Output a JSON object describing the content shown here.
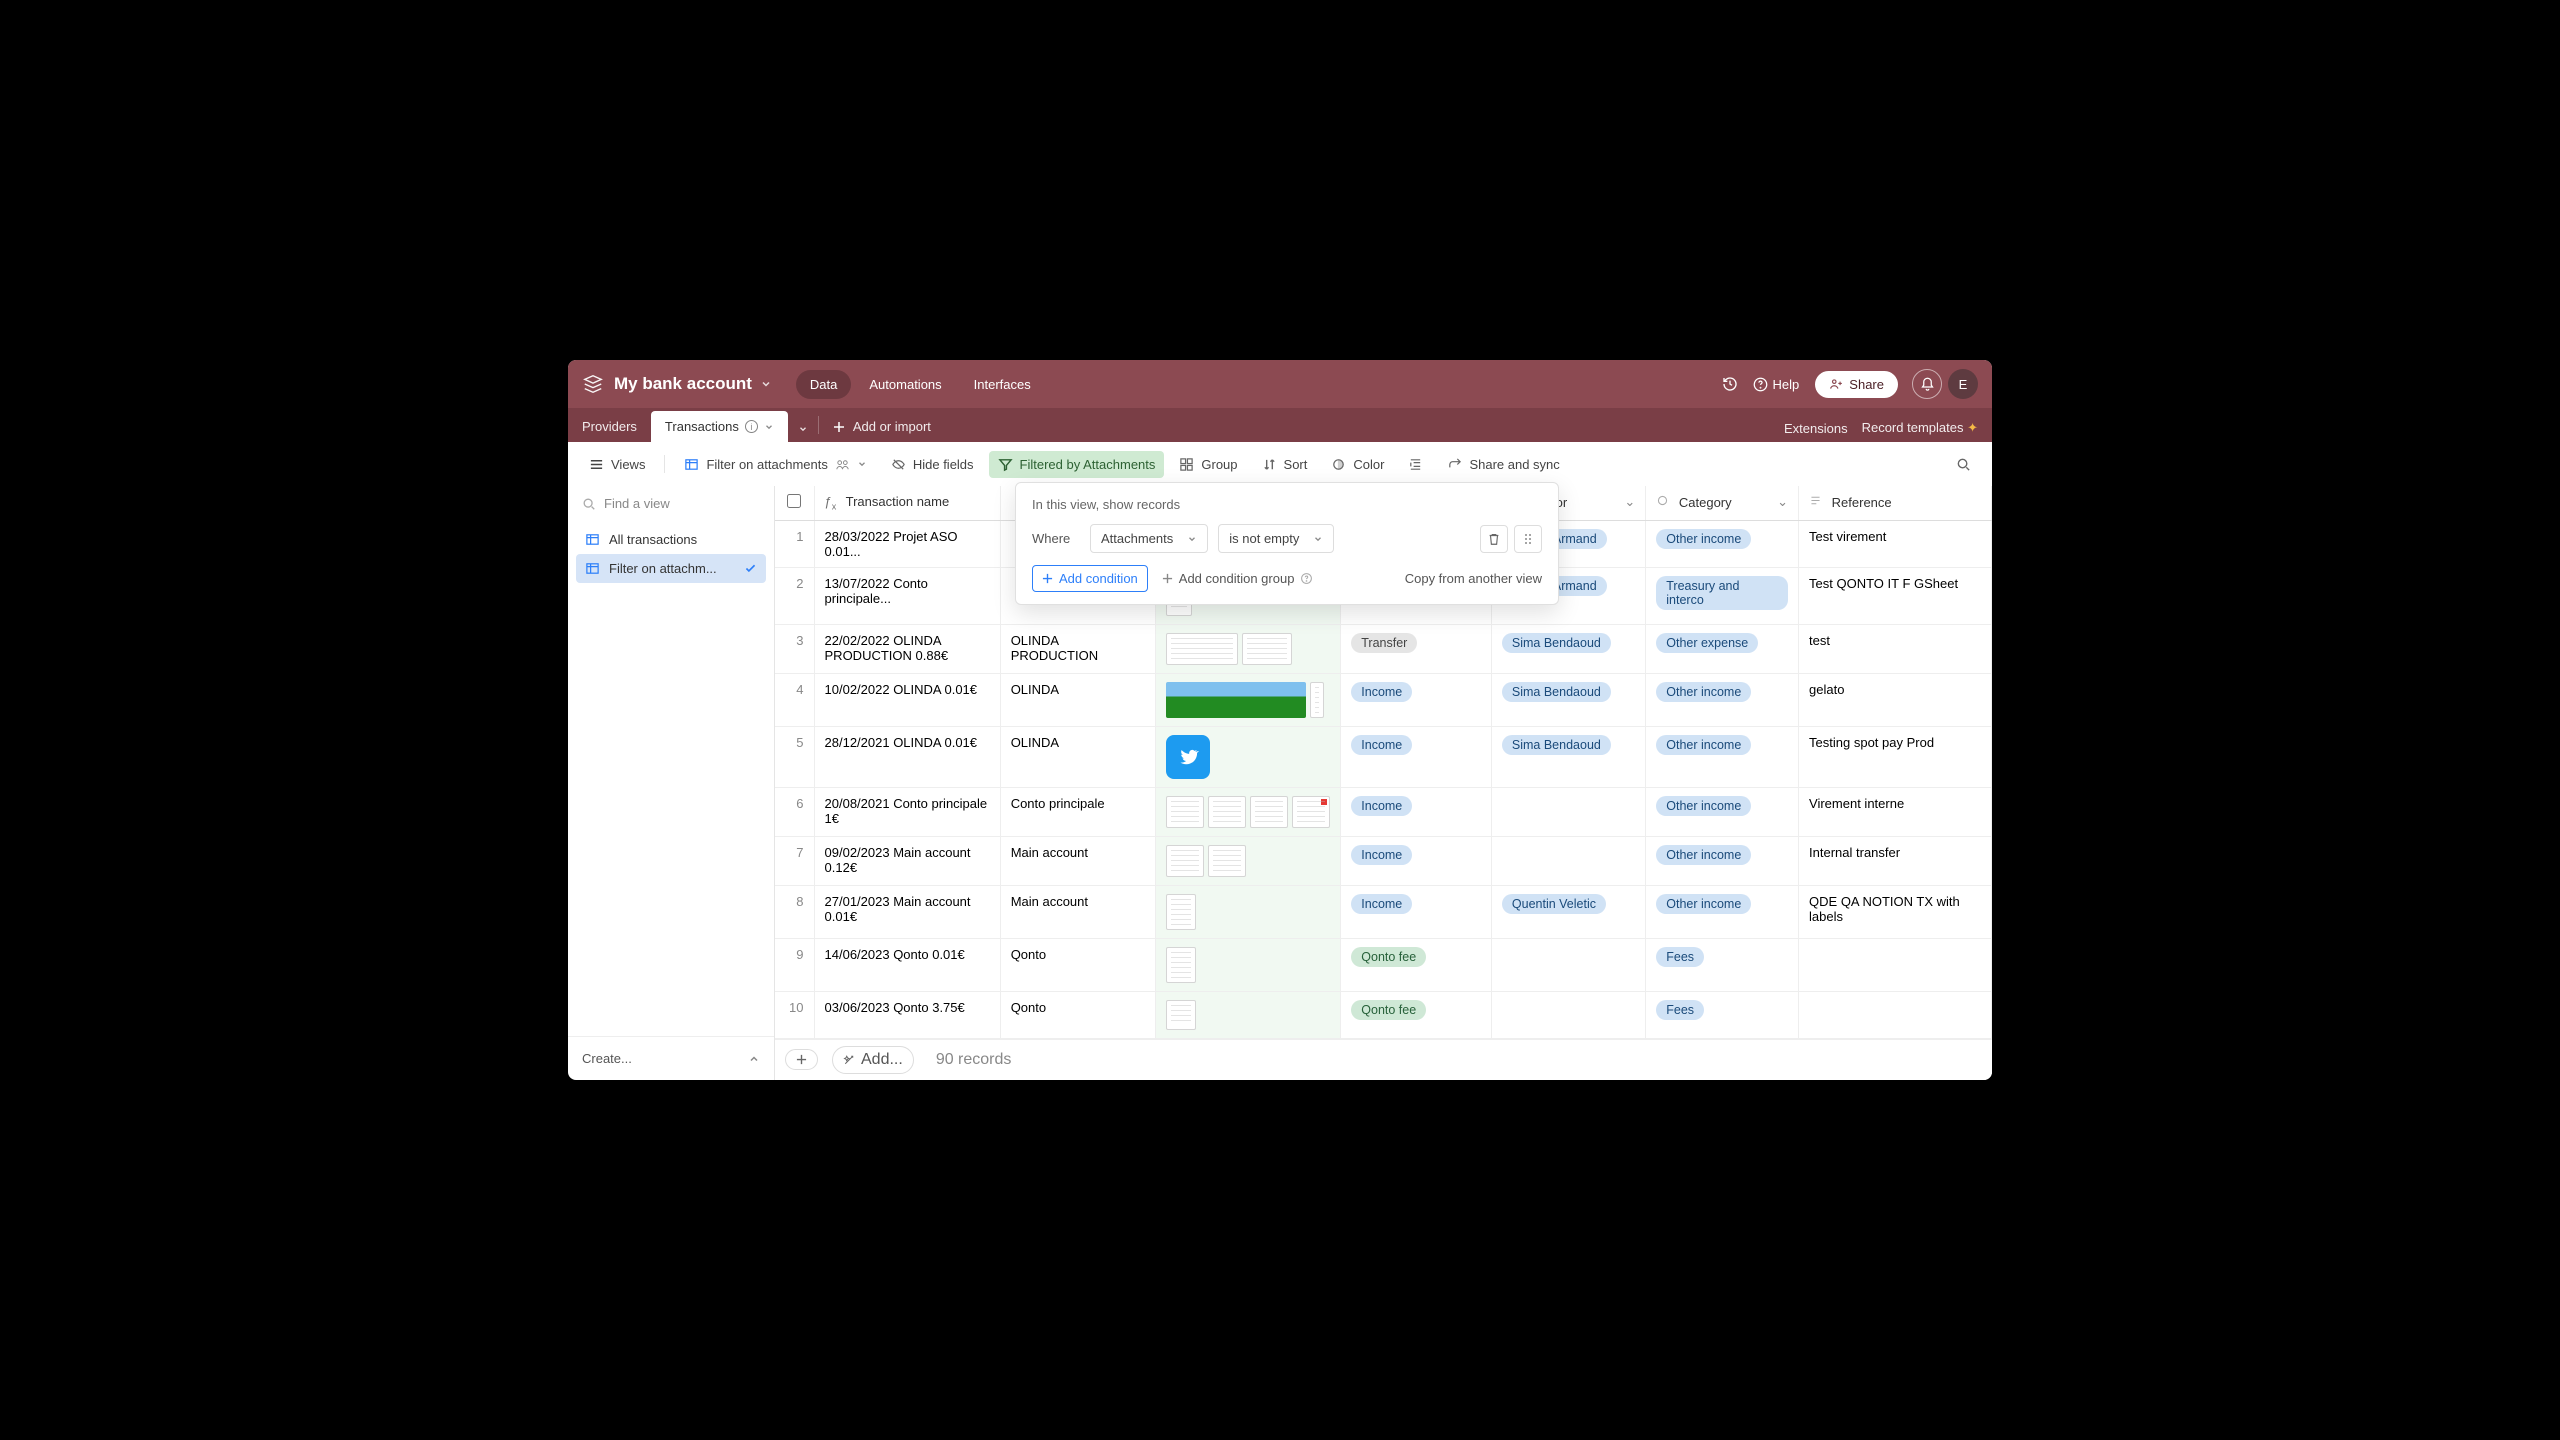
{
  "topbar": {
    "title": "My bank account",
    "nav": {
      "data": "Data",
      "automations": "Automations",
      "interfaces": "Interfaces"
    },
    "help": "Help",
    "share": "Share",
    "avatar": "E"
  },
  "tabsbar": {
    "providers": "Providers",
    "transactions": "Transactions",
    "add": "Add or import",
    "extensions": "Extensions",
    "templates": "Record templates"
  },
  "toolbar": {
    "views": "Views",
    "filter_on": "Filter on attachments",
    "hide": "Hide fields",
    "filtered": "Filtered by Attachments",
    "group": "Group",
    "sort": "Sort",
    "color": "Color",
    "share_sync": "Share and sync"
  },
  "sidebar": {
    "find_placeholder": "Find a view",
    "all": "All transactions",
    "filter_view": "Filter on attachm...",
    "create": "Create..."
  },
  "columns": {
    "name": "Transaction name",
    "initiator": "Initiator",
    "category": "Category",
    "reference": "Reference"
  },
  "popover": {
    "title": "In this view, show records",
    "where": "Where",
    "field": "Attachments",
    "op": "is not empty",
    "add_condition": "Add condition",
    "add_group": "Add condition group",
    "copy": "Copy from another view"
  },
  "rows": [
    {
      "n": "1",
      "name": "28/03/2022 Projet ASO 0.01...",
      "counter": "",
      "side": "",
      "initiator": "Florian Armand",
      "category": "Other income",
      "ref": "Test virement"
    },
    {
      "n": "2",
      "name": "13/07/2022 Conto principale...",
      "counter": "",
      "side": "",
      "initiator": "Florian Armand",
      "category": "Treasury and interco",
      "ref": "Test QONTO IT F GSheet"
    },
    {
      "n": "3",
      "name": "22/02/2022 OLINDA PRODUCTION 0.88€",
      "counter": "OLINDA PRODUCTION",
      "side": "Transfer",
      "initiator": "Sima Bendaoud",
      "category": "Other expense",
      "ref": "test"
    },
    {
      "n": "4",
      "name": "10/02/2022 OLINDA 0.01€",
      "counter": "OLINDA",
      "side": "Income",
      "initiator": "Sima Bendaoud",
      "category": "Other income",
      "ref": "gelato"
    },
    {
      "n": "5",
      "name": "28/12/2021 OLINDA 0.01€",
      "counter": "OLINDA",
      "side": "Income",
      "initiator": "Sima Bendaoud",
      "category": "Other income",
      "ref": "Testing spot pay Prod"
    },
    {
      "n": "6",
      "name": "20/08/2021 Conto principale 1€",
      "counter": "Conto principale",
      "side": "Income",
      "initiator": "",
      "category": "Other income",
      "ref": "Virement interne"
    },
    {
      "n": "7",
      "name": "09/02/2023 Main account 0.12€",
      "counter": "Main account",
      "side": "Income",
      "initiator": "",
      "category": "Other income",
      "ref": "Internal transfer"
    },
    {
      "n": "8",
      "name": "27/01/2023 Main account 0.01€",
      "counter": "Main account",
      "side": "Income",
      "initiator": "Quentin Veletic",
      "category": "Other income",
      "ref": "QDE QA NOTION TX with labels"
    },
    {
      "n": "9",
      "name": "14/06/2023 Qonto 0.01€",
      "counter": "Qonto",
      "side": "Qonto fee",
      "initiator": "",
      "category": "Fees",
      "ref": ""
    },
    {
      "n": "10",
      "name": "03/06/2023 Qonto 3.75€",
      "counter": "Qonto",
      "side": "Qonto fee",
      "initiator": "",
      "category": "Fees",
      "ref": ""
    }
  ],
  "footer": {
    "add": "Add...",
    "count": "90 records"
  },
  "colors": {
    "side": {
      "Transfer": "gray",
      "Income": "blue",
      "Qonto fee": "green"
    }
  }
}
